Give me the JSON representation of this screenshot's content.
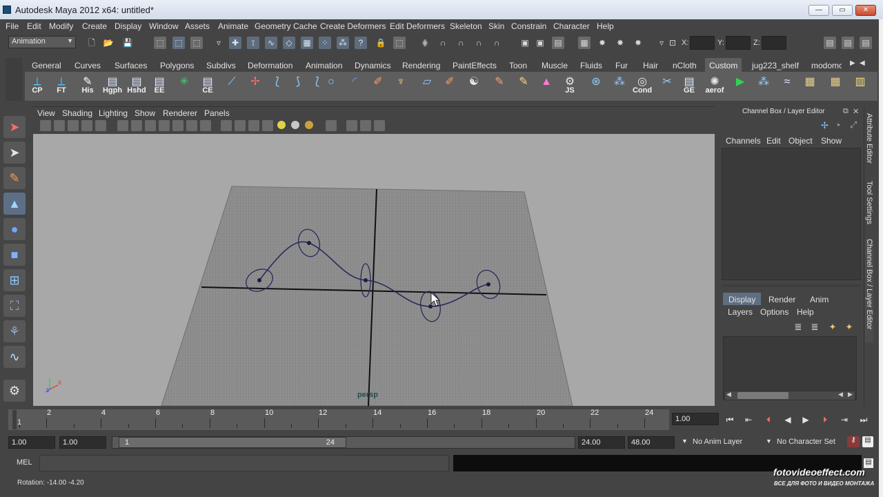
{
  "window": {
    "title": "Autodesk Maya 2012 x64: untitled*",
    "minimize_glyph": "—",
    "restore_glyph": "▭",
    "close_glyph": "✕"
  },
  "menubar": [
    "File",
    "Edit",
    "Modify",
    "Create",
    "Display",
    "Window",
    "Assets",
    "Animate",
    "Geometry Cache",
    "Create Deformers",
    "Edit Deformers",
    "Skeleton",
    "Skin",
    "Constrain",
    "Character",
    "Help"
  ],
  "statusline": {
    "mode": "Animation",
    "x_label": "X:",
    "y_label": "Y:",
    "z_label": "Z:",
    "x_value": "",
    "y_value": "",
    "z_value": ""
  },
  "shelf": {
    "tabs": [
      "General",
      "Curves",
      "Surfaces",
      "Polygons",
      "Subdivs",
      "Deformation",
      "Animation",
      "Dynamics",
      "Rendering",
      "PaintEffects",
      "Toon",
      "Muscle",
      "Fluids",
      "Fur",
      "Hair",
      "nCloth",
      "Custom",
      "jug223_shelf",
      "modomc"
    ],
    "active_tab": "Custom",
    "tools": [
      {
        "label": "CP",
        "icon": "cp-tool-icon",
        "glyph": "⟂"
      },
      {
        "label": "FT",
        "icon": "ft-tool-icon",
        "glyph": "⟂"
      },
      {
        "label": "His",
        "icon": "history-icon",
        "glyph": "✎"
      },
      {
        "label": "Hgph",
        "icon": "hypergraph-icon",
        "glyph": "▤"
      },
      {
        "label": "Hshd",
        "icon": "hypershade-icon",
        "glyph": "▤"
      },
      {
        "label": "EE",
        "icon": "expression-editor-icon",
        "glyph": "▤"
      },
      {
        "label": "",
        "icon": "star-locator-icon",
        "glyph": "✳"
      },
      {
        "label": "CE",
        "icon": "component-editor-icon",
        "glyph": "▤"
      },
      {
        "label": "",
        "icon": "joint-tool-icon",
        "glyph": "⟋"
      },
      {
        "label": "",
        "icon": "ik-handle-icon",
        "glyph": "✢"
      },
      {
        "label": "",
        "icon": "cv-curve-icon",
        "glyph": "⟅"
      },
      {
        "label": "",
        "icon": "ep-curve-icon",
        "glyph": "⟆"
      },
      {
        "label": "",
        "icon": "bezier-curve-icon",
        "glyph": "⟅"
      },
      {
        "label": "",
        "icon": "circle-icon",
        "glyph": "○"
      },
      {
        "label": "",
        "icon": "arc-icon",
        "glyph": "◜"
      },
      {
        "label": "",
        "icon": "paint-weights-icon",
        "glyph": "✐"
      },
      {
        "label": "",
        "icon": "cluster-icon",
        "glyph": "♆"
      },
      {
        "label": "",
        "icon": "lattice-icon",
        "glyph": "▱"
      },
      {
        "label": "",
        "icon": "wire-deformer-icon",
        "glyph": "✐"
      },
      {
        "label": "",
        "icon": "snap-icon",
        "glyph": "☯"
      },
      {
        "label": "",
        "icon": "brush-icon",
        "glyph": "✎"
      },
      {
        "label": "",
        "icon": "sculpt-icon",
        "glyph": "✎"
      },
      {
        "label": "",
        "icon": "cone-light-icon",
        "glyph": "▲"
      },
      {
        "label": "JS",
        "icon": "joint-size-icon",
        "glyph": "⚙"
      },
      {
        "label": "",
        "icon": "wrap-icon",
        "glyph": "⊛"
      },
      {
        "label": "",
        "icon": "spheres-icon",
        "glyph": "⁂"
      },
      {
        "label": "Cond",
        "icon": "condition-icon",
        "glyph": "◎"
      },
      {
        "label": "",
        "icon": "connect-icon",
        "glyph": "✂"
      },
      {
        "label": "GE",
        "icon": "graph-editor-icon",
        "glyph": "▤"
      },
      {
        "label": "aerof",
        "icon": "aerofoil-icon",
        "glyph": "✺"
      },
      {
        "label": "",
        "icon": "play-shelf-icon",
        "glyph": "▶"
      },
      {
        "label": "",
        "icon": "particles-icon",
        "glyph": "⁂"
      },
      {
        "label": "",
        "icon": "curve-flow-icon",
        "glyph": "≈"
      },
      {
        "label": "",
        "icon": "grid-icon",
        "glyph": "▦"
      },
      {
        "label": "",
        "icon": "grid-alt-icon",
        "glyph": "▦"
      },
      {
        "label": "",
        "icon": "notes-icon",
        "glyph": "▥"
      }
    ]
  },
  "viewport": {
    "menus": [
      "View",
      "Shading",
      "Lighting",
      "Show",
      "Renderer",
      "Panels"
    ],
    "camera_label": "persp",
    "axis_x_label": "x",
    "axis_z_label": "z"
  },
  "channelbox": {
    "title": "Channel Box / Layer Editor",
    "menus": [
      "Channels",
      "Edit",
      "Object",
      "Show"
    ],
    "layer_tabs": [
      "Display",
      "Render",
      "Anim"
    ],
    "active_layer_tab": "Display",
    "layer_menus": [
      "Layers",
      "Options",
      "Help"
    ]
  },
  "side_tabs": [
    "Attribute Editor",
    "Tool Settings",
    "Channel Box / Layer Editor"
  ],
  "timeline": {
    "current_frame": "1",
    "tick_labels": [
      "2",
      "4",
      "6",
      "8",
      "10",
      "12",
      "14",
      "16",
      "18",
      "20",
      "22",
      "24"
    ],
    "current_time": "1.00",
    "range_start": "1.00",
    "playback_start": "1.00",
    "range_min": "1",
    "range_max": "24",
    "playback_end": "24.00",
    "range_end": "48.00",
    "anim_layer": "No Anim Layer",
    "character_set": "No Character Set",
    "playback_buttons": [
      "⏮",
      "⇤",
      "⏴",
      "◀",
      "▶",
      "⏵",
      "⇥",
      "⏭"
    ]
  },
  "command_line": {
    "label": "MEL",
    "input": "",
    "output": ""
  },
  "help_line": {
    "label": "Rotation:",
    "value1": "-14.00",
    "value2": "-4.20"
  },
  "watermark": {
    "line1": "fotovideoeffect.com",
    "line2": "ВСЕ ДЛЯ ФОТО И ВИДЕО МОНТАЖА"
  },
  "colors": {
    "ui_background": "#444444",
    "viewport_background": "#a8a8a8",
    "active_tab": "#5e5e5e",
    "curve_color": "#29295c",
    "selected_tool": "#5d6f86"
  }
}
